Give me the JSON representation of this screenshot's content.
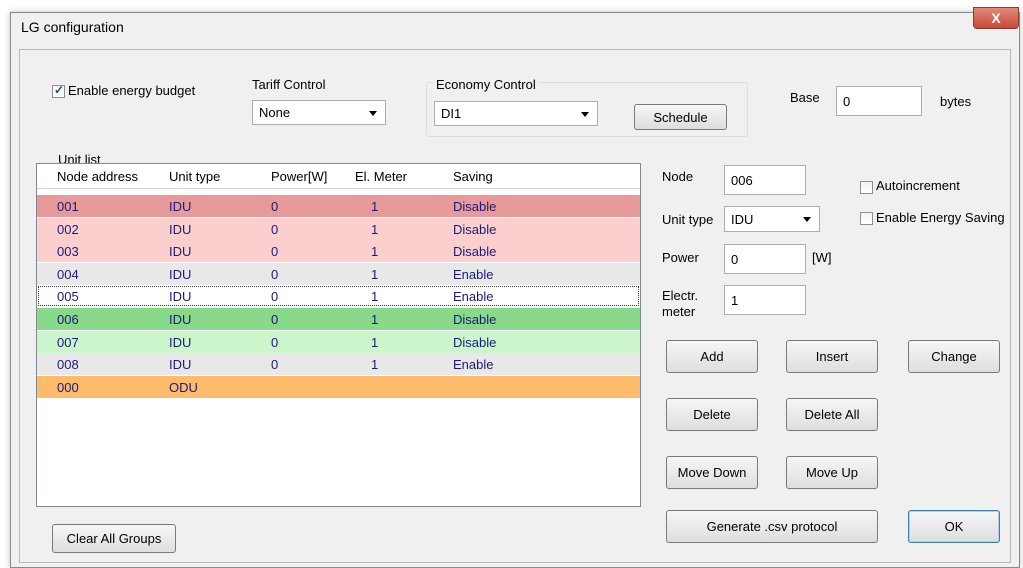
{
  "window": {
    "title": "LG configuration",
    "close_glyph": "X"
  },
  "enable_budget": {
    "label": "Enable energy budget",
    "checked": true
  },
  "tariff": {
    "label": "Tariff Control",
    "value": "None"
  },
  "economy": {
    "label": "Economy Control",
    "value": "DI1",
    "schedule": "Schedule"
  },
  "base": {
    "label": "Base",
    "value": "0",
    "unit": "bytes"
  },
  "unit_list": {
    "label": "Unit list",
    "columns": [
      "Node address",
      "Unit type",
      "Power[W]",
      "El. Meter",
      "Saving"
    ],
    "rows": [
      {
        "node": "001",
        "type": "IDU",
        "power": "0",
        "meter": "1",
        "saving": "Disable",
        "color": "#e89a9a"
      },
      {
        "node": "002",
        "type": "IDU",
        "power": "0",
        "meter": "1",
        "saving": "Disable",
        "color": "#fccfcf"
      },
      {
        "node": "003",
        "type": "IDU",
        "power": "0",
        "meter": "1",
        "saving": "Disable",
        "color": "#fccfcf"
      },
      {
        "node": "004",
        "type": "IDU",
        "power": "0",
        "meter": "1",
        "saving": "Enable",
        "color": "#e8e8e8"
      },
      {
        "node": "005",
        "type": "IDU",
        "power": "0",
        "meter": "1",
        "saving": "Enable",
        "color": "#ffffff"
      },
      {
        "node": "006",
        "type": "IDU",
        "power": "0",
        "meter": "1",
        "saving": "Disable",
        "color": "#88d98a"
      },
      {
        "node": "007",
        "type": "IDU",
        "power": "0",
        "meter": "1",
        "saving": "Disable",
        "color": "#ccf5cc"
      },
      {
        "node": "008",
        "type": "IDU",
        "power": "0",
        "meter": "1",
        "saving": "Enable",
        "color": "#e8e8e8"
      },
      {
        "node": "000",
        "type": "ODU",
        "power": "",
        "meter": "",
        "saving": "",
        "color": "#fdbb6b"
      }
    ]
  },
  "form": {
    "node_label": "Node",
    "node_value": "006",
    "unit_type_label": "Unit type",
    "unit_type_value": "IDU",
    "power_label": "Power",
    "power_value": "0",
    "power_unit": "[W]",
    "meter_label_1": "Electr.",
    "meter_label_2": "meter",
    "meter_value": "1",
    "autoincrement": {
      "label": "Autoincrement",
      "checked": false
    },
    "enable_saving": {
      "label": "Enable Energy Saving",
      "checked": false
    }
  },
  "buttons": {
    "add": "Add",
    "insert": "Insert",
    "change": "Change",
    "delete": "Delete",
    "delete_all": "Delete All",
    "move_down": "Move Down",
    "move_up": "Move Up",
    "generate": "Generate .csv protocol",
    "ok": "OK",
    "clear_groups": "Clear All Groups"
  }
}
